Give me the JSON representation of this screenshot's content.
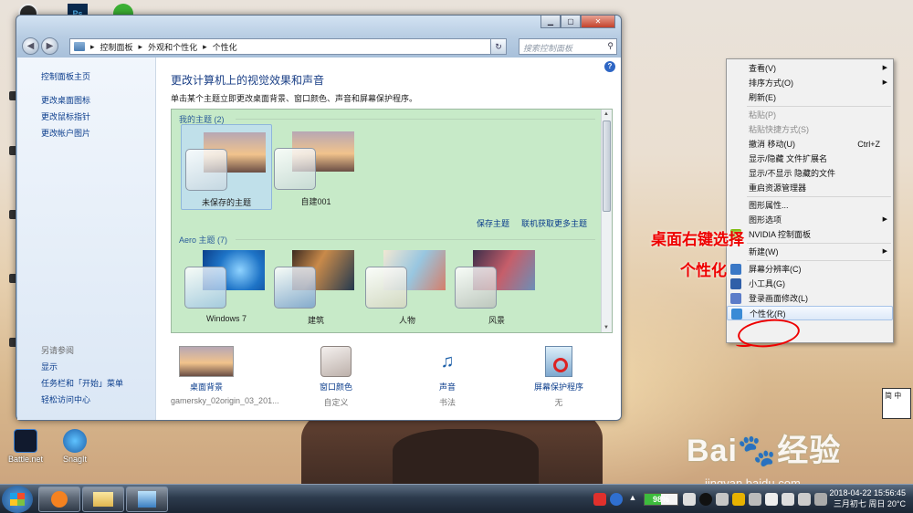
{
  "desktop": {
    "icons": [
      {
        "name": "Battle.net"
      },
      {
        "name": "SnagIt"
      }
    ],
    "annotation": {
      "line1": "桌面右键选择",
      "line2": "个性化"
    },
    "watermark": {
      "brand": "Bai🐾经验",
      "url": "jingyan.baidu.com"
    },
    "widget_label": "简 中"
  },
  "window": {
    "breadcrumb": [
      "控制面板",
      "外观和个性化",
      "个性化"
    ],
    "breadcrumb_sep": "▸",
    "search_placeholder": "搜索控制面板",
    "controls": {
      "min": "▁",
      "max": "▢",
      "close": "✕"
    },
    "sidebar": {
      "home": "控制面板主页",
      "links": [
        "更改桌面图标",
        "更改鼠标指针",
        "更改帐户图片"
      ],
      "see_also_header": "另请参阅",
      "see_also": [
        "显示",
        "任务栏和「开始」菜单",
        "轻松访问中心"
      ]
    },
    "content": {
      "title": "更改计算机上的视觉效果和声音",
      "subtitle": "单击某个主题立即更改桌面背景、窗口颜色、声音和屏幕保护程序。",
      "my_themes_header": "我的主题 (2)",
      "my_themes": [
        "未保存的主题",
        "自建001"
      ],
      "save_theme": "保存主题",
      "get_more": "联机获取更多主题",
      "aero_header": "Aero 主题 (7)",
      "aero_themes": [
        "Windows 7",
        "建筑",
        "人物",
        "风景"
      ],
      "bottom": [
        {
          "label": "桌面背景",
          "sub": "gamersky_02origin_03_201..."
        },
        {
          "label": "窗口颜色",
          "sub": "自定义"
        },
        {
          "label": "声音",
          "sub": "书法"
        },
        {
          "label": "屏幕保护程序",
          "sub": "无"
        }
      ]
    }
  },
  "context_menu": {
    "items": [
      {
        "label": "查看(V)",
        "sub": true
      },
      {
        "label": "排序方式(O)",
        "sub": true
      },
      {
        "label": "刷新(E)"
      },
      {
        "sep": true
      },
      {
        "label": "粘贴(P)",
        "disabled": true
      },
      {
        "label": "粘贴快捷方式(S)",
        "disabled": true
      },
      {
        "label": "撤消 移动(U)",
        "shortcut": "Ctrl+Z"
      },
      {
        "label": "显示/隐藏 文件扩展名"
      },
      {
        "label": "显示/不显示 隐藏的文件"
      },
      {
        "label": "重启资源管理器"
      },
      {
        "sep": true
      },
      {
        "label": "图形属性..."
      },
      {
        "label": "图形选项",
        "sub": true
      },
      {
        "label": "NVIDIA 控制面板",
        "icon": "nvidia-icon"
      },
      {
        "sep": true
      },
      {
        "label": "新建(W)",
        "sub": true
      },
      {
        "sep": true
      },
      {
        "label": "屏幕分辨率(C)",
        "icon": "display-icon"
      },
      {
        "label": "小工具(G)",
        "icon": "gadget-icon"
      },
      {
        "label": "登录画面修改(L)",
        "icon": "logon-icon"
      },
      {
        "label": "个性化(R)",
        "icon": "personalize-icon",
        "highlight": true
      }
    ]
  },
  "taskbar": {
    "battery": "98%",
    "clock_time": "2018-04-22  15:56:45",
    "clock_date": "三月初七 周日 20°C"
  },
  "colors": {
    "accent": "#0b3d8c",
    "theme_panel": "#c7eac8",
    "annotation": "#ee0000"
  }
}
